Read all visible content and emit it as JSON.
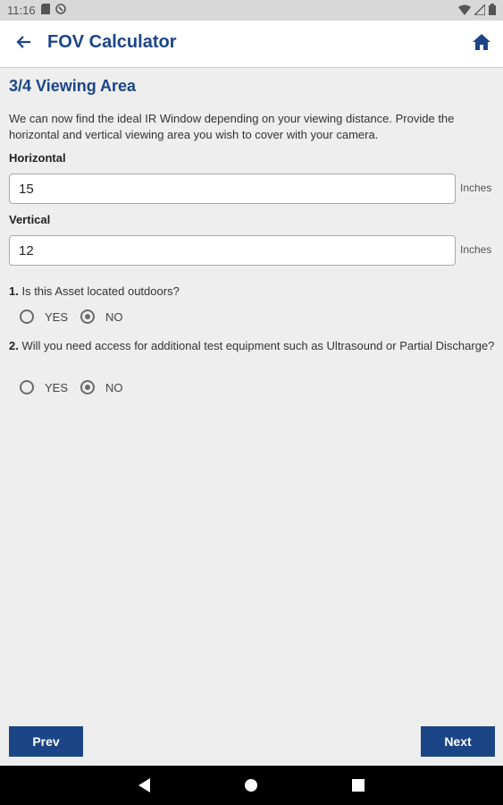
{
  "status_bar": {
    "time": "11:16"
  },
  "app_bar": {
    "title": "FOV Calculator"
  },
  "step": {
    "title": "3/4 Viewing Area",
    "description": "We can now find the ideal IR Window depending on your viewing distance. Provide the horizontal and vertical viewing area you wish to cover with your camera."
  },
  "horizontal": {
    "label": "Horizontal",
    "value": "15",
    "unit": "Inches"
  },
  "vertical": {
    "label": "Vertical",
    "value": "12",
    "unit": "Inches"
  },
  "questions": [
    {
      "number": "1.",
      "text": "Is this Asset located outdoors?",
      "options": [
        "YES",
        "NO"
      ],
      "selected": "NO"
    },
    {
      "number": "2.",
      "text": "Will you need access for additional test equipment such as Ultrasound or Partial Discharge?",
      "options": [
        "YES",
        "NO"
      ],
      "selected": "NO"
    }
  ],
  "buttons": {
    "prev": "Prev",
    "next": "Next"
  },
  "colors": {
    "primary": "#1c4587",
    "background": "#eeeeee"
  },
  "icons": [
    "back-arrow-icon",
    "home-icon",
    "sim-card-icon",
    "sync-icon",
    "wifi-icon",
    "signal-icon",
    "battery-icon",
    "nav-back-icon",
    "nav-home-icon",
    "nav-recents-icon"
  ]
}
